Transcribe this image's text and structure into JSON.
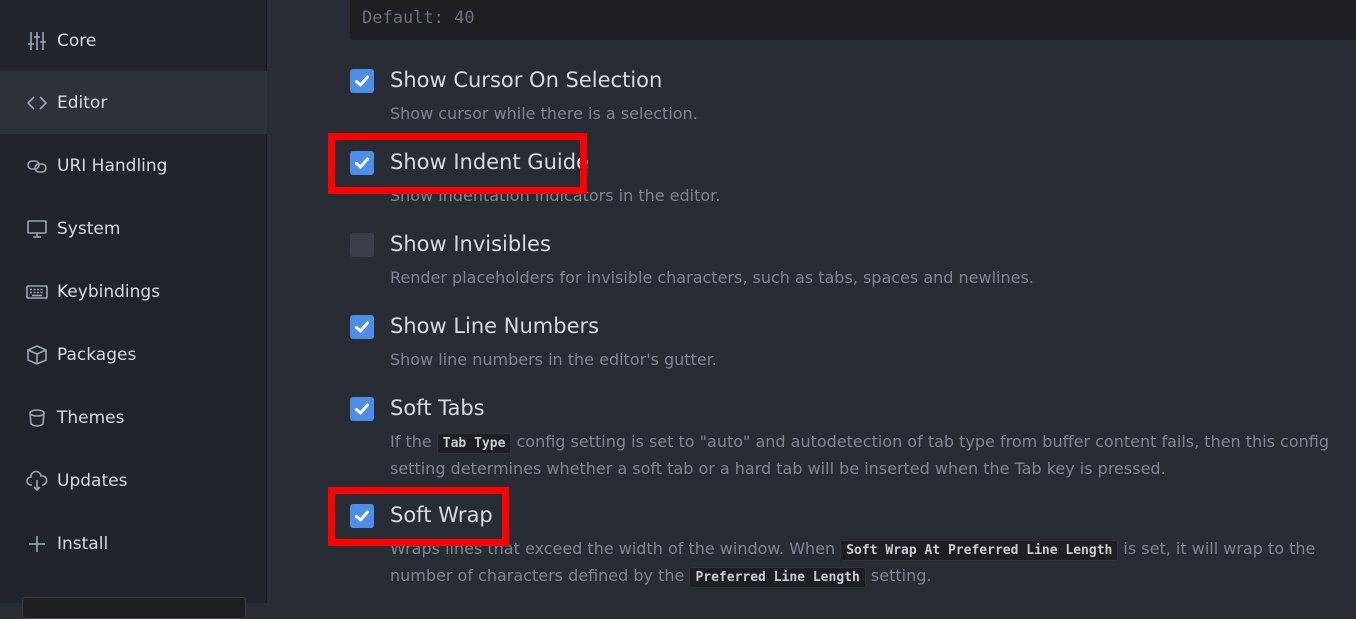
{
  "sidebar": {
    "items": [
      {
        "label": "Core",
        "icon": "sliders-icon"
      },
      {
        "label": "Editor",
        "icon": "code-icon",
        "active": true
      },
      {
        "label": "URI Handling",
        "icon": "link-icon"
      },
      {
        "label": "System",
        "icon": "monitor-icon"
      },
      {
        "label": "Keybindings",
        "icon": "keyboard-icon"
      },
      {
        "label": "Packages",
        "icon": "package-icon"
      },
      {
        "label": "Themes",
        "icon": "paintcan-icon"
      },
      {
        "label": "Updates",
        "icon": "cloud-download-icon"
      },
      {
        "label": "Install",
        "icon": "plus-icon"
      }
    ]
  },
  "main": {
    "default_text": "Default: 40",
    "settings": [
      {
        "title": "Show Cursor On Selection",
        "checked": true,
        "desc": "Show cursor while there is a selection."
      },
      {
        "title": "Show Indent Guide",
        "checked": true,
        "desc": "Show indentation indicators in the editor."
      },
      {
        "title": "Show Invisibles",
        "checked": false,
        "desc": "Render placeholders for invisible characters, such as tabs, spaces and newlines."
      },
      {
        "title": "Show Line Numbers",
        "checked": true,
        "desc": "Show line numbers in the editor's gutter."
      },
      {
        "title": "Soft Tabs",
        "checked": true,
        "desc_parts": [
          "If the ",
          "Tab Type",
          " config setting is set to \"auto\" and autodetection of tab type from buffer content fails, then this config setting determines whether a soft tab or a hard tab will be inserted when the Tab key is pressed."
        ]
      },
      {
        "title": "Soft Wrap",
        "checked": true,
        "desc_parts": [
          "Wraps lines that exceed the width of the window. When ",
          "Soft Wrap At Preferred Line Length",
          " is set, it will wrap to the number of characters defined by the ",
          "Preferred Line Length",
          " setting."
        ]
      }
    ]
  },
  "colors": {
    "accent": "#4d8ee8",
    "highlight": "#ff0000",
    "background": "#282c34",
    "sidebar": "#21252b"
  }
}
